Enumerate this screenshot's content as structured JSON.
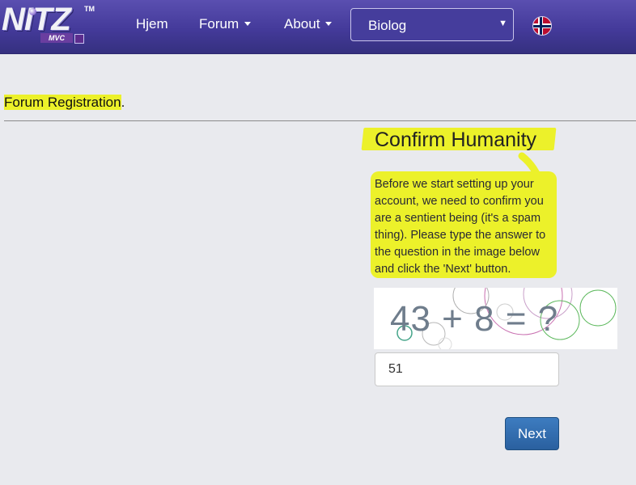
{
  "brand": {
    "logo_text": "NITZ",
    "logo_sub": "MVC",
    "trademark": "TM"
  },
  "nav": {
    "home": "Hjem",
    "forum": "Forum",
    "about": "About",
    "select_value": "Biolog",
    "language_icon": "norway-flag-icon"
  },
  "page": {
    "breadcrumb": "Forum Registration",
    "breadcrumb_suffix": "."
  },
  "humanity": {
    "title": "Confirm Humanity",
    "instructions": "Before we start setting up your account, we need to confirm you are a sentient being (it's a spam thing). Please type the answer to the question in the image below and click the 'Next' button.",
    "captcha_question": "43 + 8 = ?",
    "answer_value": "51",
    "next_label": "Next"
  },
  "colors": {
    "navbar": "#453d9c",
    "highlight": "#ecf12a",
    "button": "#2f6aa8",
    "background": "#e9eaee"
  }
}
